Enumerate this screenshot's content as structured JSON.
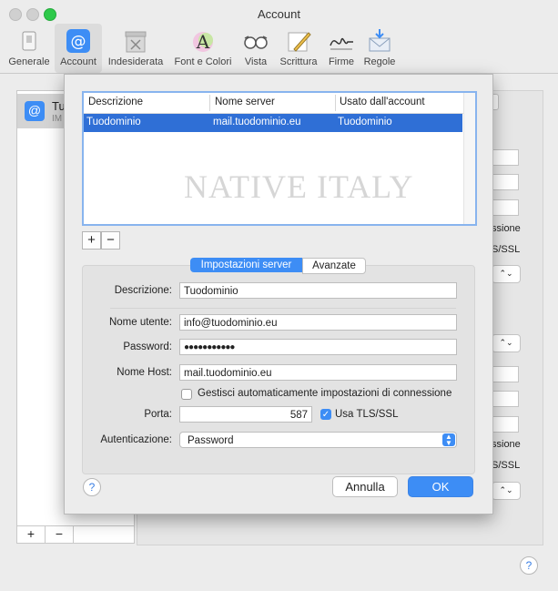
{
  "window": {
    "title": "Account"
  },
  "toolbar": {
    "items": [
      {
        "label": "Generale",
        "icon": "general-icon"
      },
      {
        "label": "Account",
        "icon": "at-sign-icon"
      },
      {
        "label": "Indesiderata",
        "icon": "junk-mail-icon"
      },
      {
        "label": "Font e Colori",
        "icon": "fonts-colors-icon"
      },
      {
        "label": "Vista",
        "icon": "glasses-icon"
      },
      {
        "label": "Scrittura",
        "icon": "pencil-icon"
      },
      {
        "label": "Firme",
        "icon": "signature-icon"
      },
      {
        "label": "Regole",
        "icon": "rules-icon"
      }
    ]
  },
  "background": {
    "account_name": "Tu",
    "account_sub": "IM",
    "right_texts": [
      "ssione",
      "S/SSL",
      "ssione",
      "S/SSL"
    ],
    "list_buttons": [
      "+",
      "−"
    ],
    "help": "?"
  },
  "sheet": {
    "table": {
      "columns": [
        "Descrizione",
        "Nome server",
        "Usato dall'account"
      ],
      "rows": [
        {
          "descrizione": "Tuodominio",
          "nome_server": "mail.tuodominio.eu",
          "usato": "Tuodominio"
        }
      ]
    },
    "watermark": "NATIVE ITALY",
    "add_button": "+",
    "remove_button": "−",
    "tabs": {
      "server": "Impostazioni server",
      "advanced": "Avanzate"
    },
    "fields": {
      "descrizione": {
        "label": "Descrizione:",
        "value": "Tuodominio"
      },
      "nome_utente": {
        "label": "Nome utente:",
        "value": "info@tuodominio.eu"
      },
      "password": {
        "label": "Password:",
        "value": "●●●●●●●●●●●"
      },
      "nome_host": {
        "label": "Nome Host:",
        "value": "mail.tuodominio.eu"
      },
      "auto_manage": {
        "label": "Gestisci automaticamente impostazioni di connessione",
        "checked": false
      },
      "porta": {
        "label": "Porta:",
        "value": "587"
      },
      "tls": {
        "label": "Usa TLS/SSL",
        "checked": true
      },
      "autenticazione": {
        "label": "Autenticazione:",
        "value": "Password"
      }
    },
    "help": "?",
    "cancel": "Annulla",
    "ok": "OK"
  },
  "colors": {
    "accent": "#3d8df5",
    "selection": "#2f6fd6"
  }
}
